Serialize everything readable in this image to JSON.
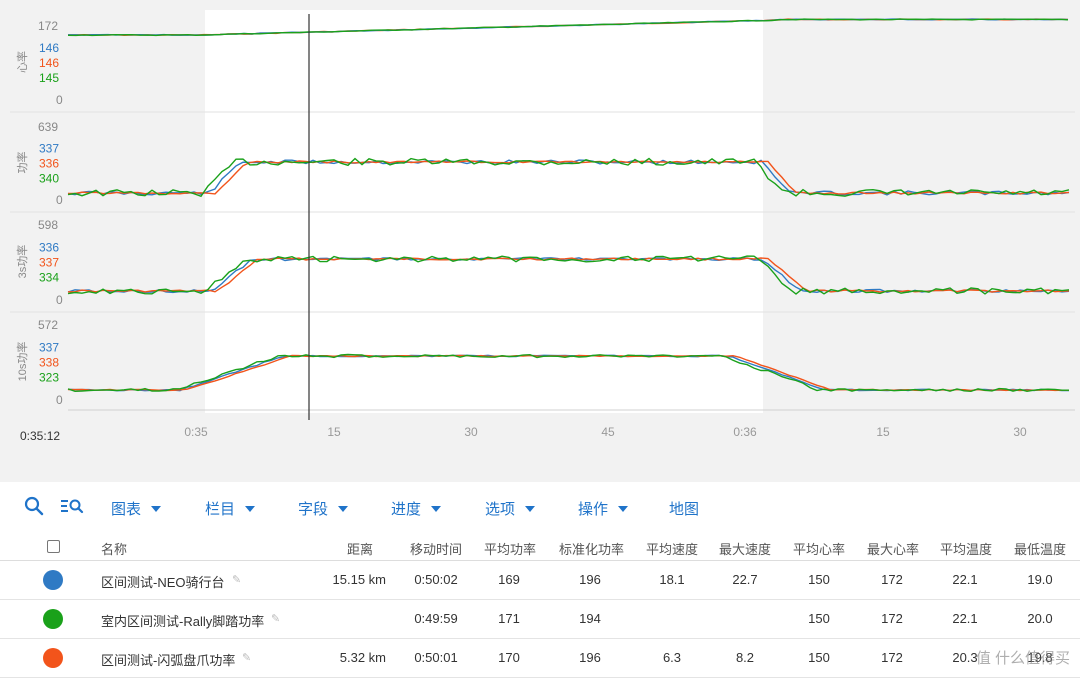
{
  "chart": {
    "time_start_label": "0:35:12",
    "x_ticks": [
      "0:35",
      "15",
      "30",
      "45",
      "0:36",
      "15",
      "30"
    ],
    "colors": {
      "blue": "#2f7ac4",
      "orange": "#f2541b",
      "green": "#1aa11a"
    },
    "panels": [
      {
        "label": "心率",
        "max": "172",
        "min": "0",
        "values": [
          "146",
          "146",
          "145"
        ]
      },
      {
        "label": "功率",
        "max": "639",
        "min": "0",
        "values": [
          "337",
          "336",
          "340"
        ]
      },
      {
        "label": "3s功率",
        "max": "598",
        "min": "0",
        "values": [
          "336",
          "337",
          "334"
        ]
      },
      {
        "label": "10s功率",
        "max": "572",
        "min": "0",
        "values": [
          "337",
          "338",
          "323"
        ]
      }
    ]
  },
  "toolbar": {
    "search_icon": "search-icon",
    "filter_icon": "list-search-icon",
    "menus": [
      "图表",
      "栏目",
      "字段",
      "进度",
      "选项",
      "操作"
    ],
    "map": "地图"
  },
  "table": {
    "headers": [
      "名称",
      "距离",
      "移动时间",
      "平均功率",
      "标准化功率",
      "平均速度",
      "最大速度",
      "平均心率",
      "最大心率",
      "平均温度",
      "最低温度"
    ],
    "rows": [
      {
        "color": "#2f7ac4",
        "name": "区间测试-NEO骑行台",
        "distance": "15.15 km",
        "moving_time": "0:50:02",
        "avg_power": "169",
        "np": "196",
        "avg_speed": "18.1",
        "max_speed": "22.7",
        "avg_hr": "150",
        "max_hr": "172",
        "avg_temp": "22.1",
        "min_temp": "19.0"
      },
      {
        "color": "#1aa11a",
        "name": "室内区间测试-Rally脚踏功率",
        "distance": "",
        "moving_time": "0:49:59",
        "avg_power": "171",
        "np": "194",
        "avg_speed": "",
        "max_speed": "",
        "avg_hr": "150",
        "max_hr": "172",
        "avg_temp": "22.1",
        "min_temp": "20.0"
      },
      {
        "color": "#f2541b",
        "name": "区间测试-闪弧盘爪功率",
        "distance": "5.32 km",
        "moving_time": "0:50:01",
        "avg_power": "170",
        "np": "196",
        "avg_speed": "6.3",
        "max_speed": "8.2",
        "avg_hr": "150",
        "max_hr": "172",
        "avg_temp": "20.3",
        "min_temp": "19.8"
      }
    ]
  },
  "watermark": "值 什么值得买"
}
